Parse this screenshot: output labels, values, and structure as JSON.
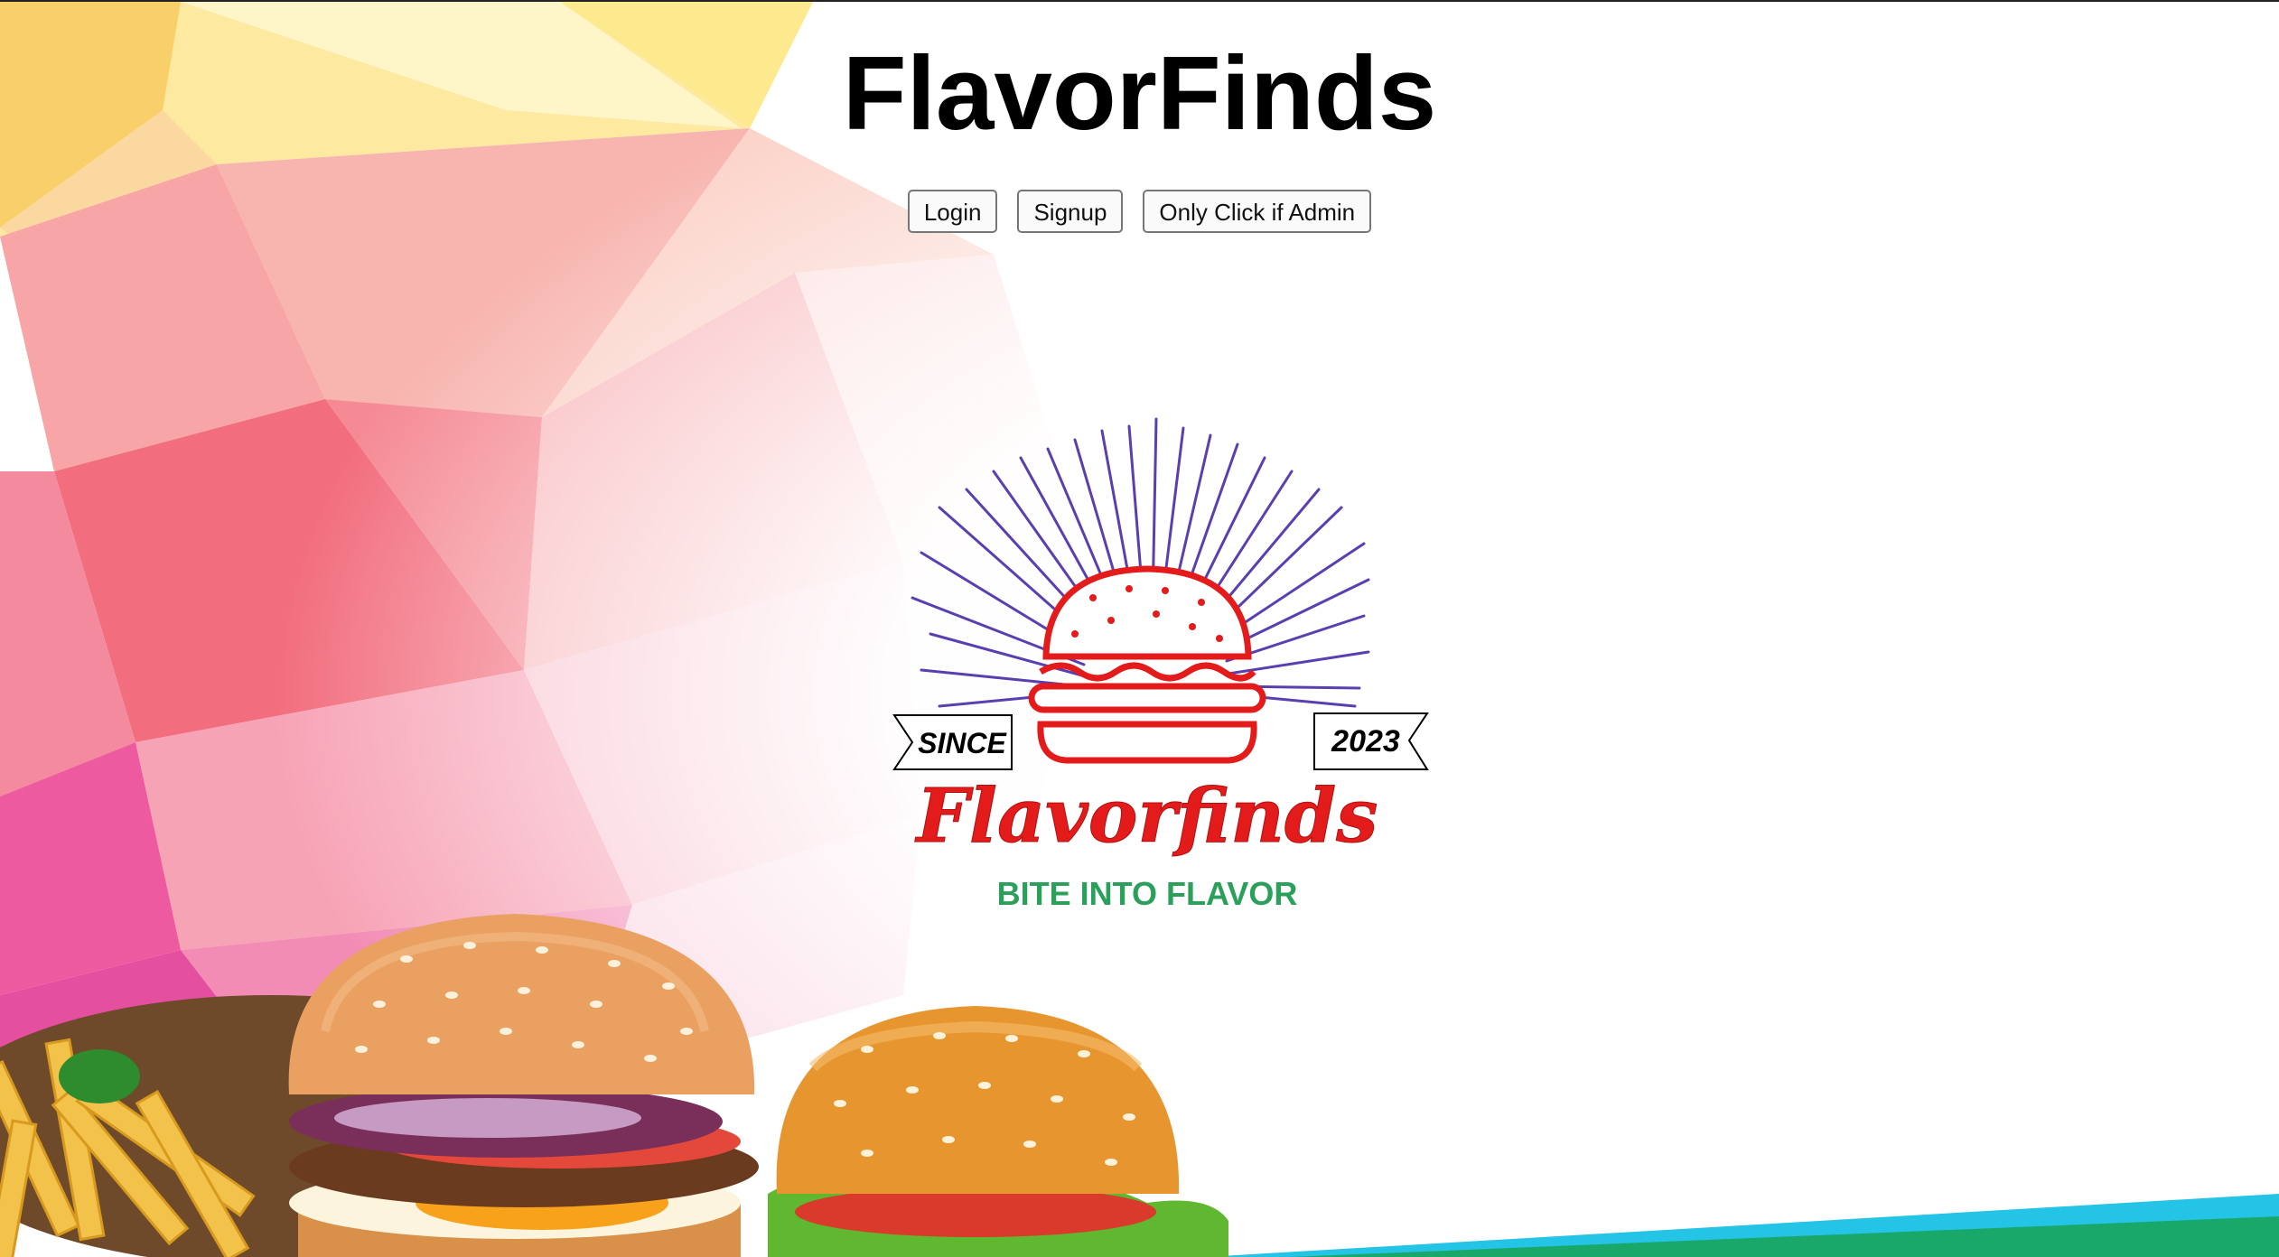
{
  "header": {
    "title": "FlavorFinds"
  },
  "nav": {
    "login_label": "Login",
    "signup_label": "Signup",
    "admin_label": "Only Click if Admin"
  },
  "logo": {
    "since_label": "SINCE",
    "year_label": "2023",
    "brand_name": "Flavorfinds",
    "tagline": "BITE INTO FLAVOR"
  },
  "colors": {
    "logo_red": "#e31b1b",
    "logo_green": "#2aa05a",
    "rays_purple": "#5a3fb0",
    "accent_pink": "#f4607a",
    "accent_yellow": "#fbe27a"
  }
}
